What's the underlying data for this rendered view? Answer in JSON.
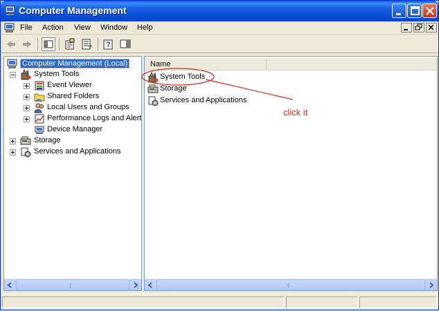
{
  "window": {
    "title": "Computer Management",
    "app_icon": "computer-management-icon"
  },
  "menu": {
    "items": [
      "File",
      "Action",
      "View",
      "Window",
      "Help"
    ]
  },
  "tree": {
    "root": "Computer Management (Local)",
    "system_tools": "System Tools",
    "event_viewer": "Event Viewer",
    "shared_folders": "Shared Folders",
    "local_users": "Local Users and Groups",
    "performance_logs": "Performance Logs and Alerts",
    "device_manager": "Device Manager",
    "storage": "Storage",
    "services": "Services and Applications"
  },
  "list": {
    "column_name": "Name",
    "items": [
      "System Tools",
      "Storage",
      "Services and Applications"
    ]
  },
  "annotation": {
    "text": "click it",
    "color": "#d8291a"
  },
  "scrollbar": {
    "grip": "|||"
  },
  "colors": {
    "titlebar": "#0a5ce6",
    "selection": "#316ac5"
  }
}
